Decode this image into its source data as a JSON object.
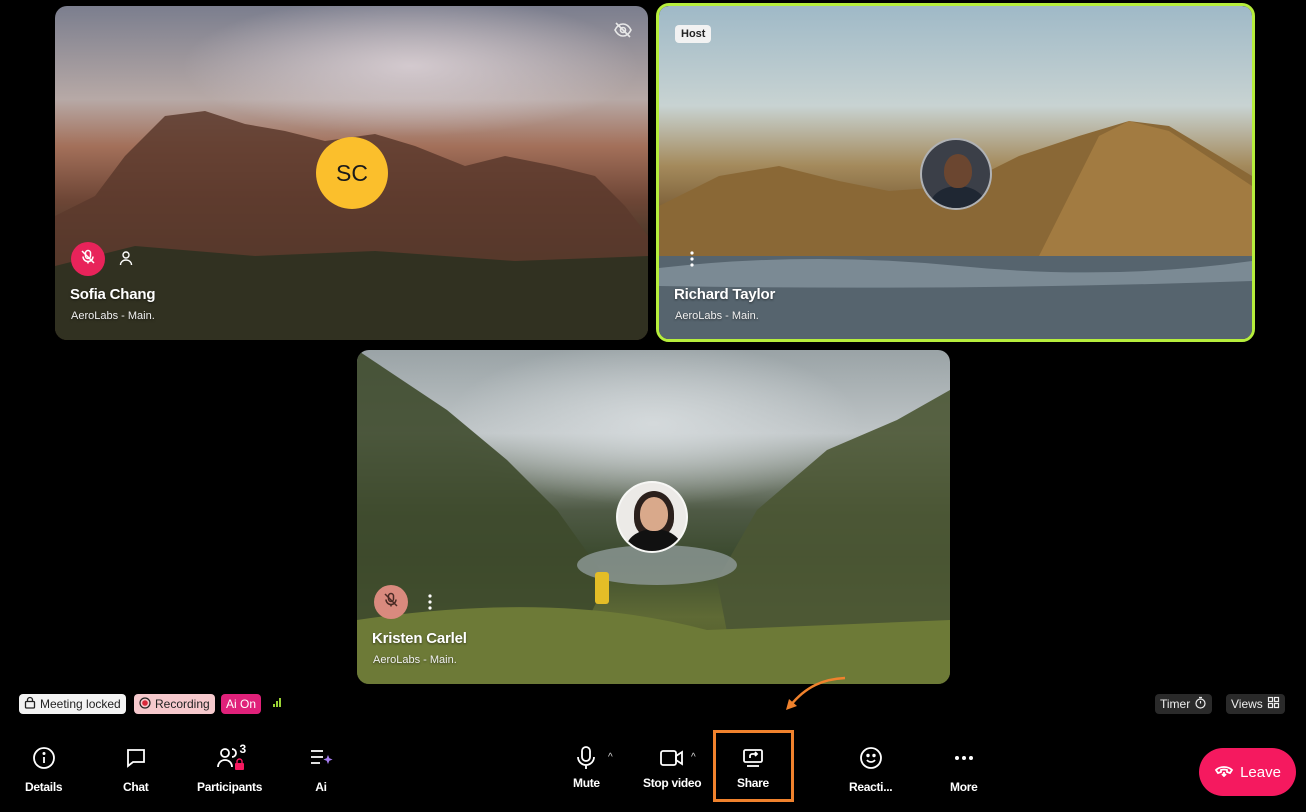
{
  "participants": [
    {
      "name": "Sofia Chang",
      "org": "AeroLabs - Main.",
      "initials": "SC"
    },
    {
      "name": "Richard Taylor",
      "org": "AeroLabs - Main.",
      "badge": "Host"
    },
    {
      "name": "Kristen Carlel",
      "org": "AeroLabs - Main."
    }
  ],
  "status": {
    "meeting_locked": "Meeting locked",
    "recording": "Recording",
    "ai": "Ai On",
    "timer": "Timer",
    "views": "Views"
  },
  "toolbar": {
    "details": "Details",
    "chat": "Chat",
    "participants": "Participants",
    "participants_count": "3",
    "ai": "Ai",
    "mute": "Mute",
    "stop_video": "Stop video",
    "share": "Share",
    "reactions": "Reacti...",
    "more": "More",
    "leave": "Leave"
  },
  "colors": {
    "active_speaker_border": "#b6ee3c",
    "initials_avatar": "#fbbf2c",
    "leave": "#f5195f",
    "highlight": "#f0822d",
    "ai_chip": "#e0217a"
  }
}
